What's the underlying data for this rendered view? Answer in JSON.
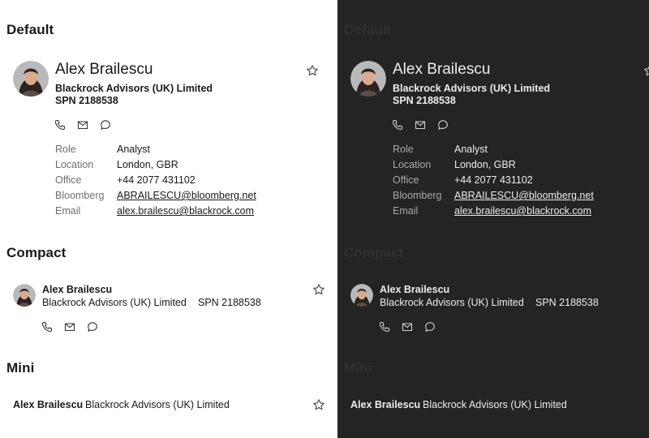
{
  "sections": {
    "default": "Default",
    "compact": "Compact",
    "mini": "Mini"
  },
  "contact": {
    "name": "Alex Brailescu",
    "firm": "Blackrock Advisors (UK) Limited",
    "spn": "SPN 2188538",
    "details": [
      {
        "label": "Role",
        "value": "Analyst"
      },
      {
        "label": "Location",
        "value": "London, GBR"
      },
      {
        "label": "Office",
        "value": "+44 2077 431102"
      },
      {
        "label": "Bloomberg",
        "value": "ABRAILESCU@bloomberg.net"
      },
      {
        "label": "Email",
        "value": "alex.brailescu@blackrock.com"
      }
    ]
  },
  "icons": {
    "call": "phone-icon",
    "email": "mail-icon",
    "chat": "chat-icon",
    "favorite": "star-icon"
  },
  "themes": {
    "light": {
      "background": "#ffffff",
      "text": "#1a1a1a"
    },
    "dark": {
      "background": "#242424",
      "text": "#ececec"
    }
  }
}
